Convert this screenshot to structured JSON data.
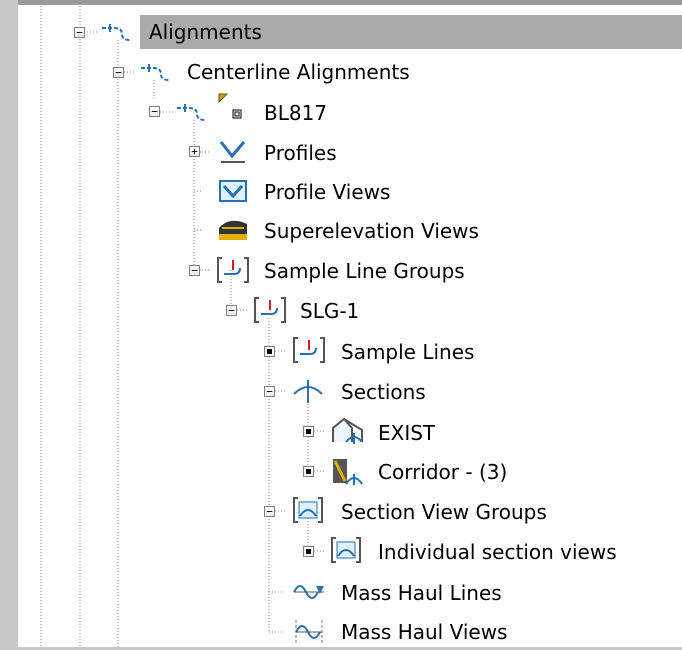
{
  "tree": {
    "alignments": "Alignments",
    "centerline_alignments": "Centerline Alignments",
    "bl817": "BL817",
    "profiles": "Profiles",
    "profile_views": "Profile Views",
    "superelevation_views": "Superelevation Views",
    "sample_line_groups": "Sample Line Groups",
    "slg1": "SLG-1",
    "sample_lines": "Sample Lines",
    "sections": "Sections",
    "exist": "EXIST",
    "corridor": "Corridor - (3)",
    "section_view_groups": "Section View Groups",
    "individual_section_views": "Individual section views",
    "mass_haul_lines": "Mass Haul Lines",
    "mass_haul_views": "Mass Haul Views"
  },
  "colors": {
    "selected_row": "#aaaaaa",
    "accent_red": "#d02020",
    "icon_blue": "#2a6fb0"
  }
}
